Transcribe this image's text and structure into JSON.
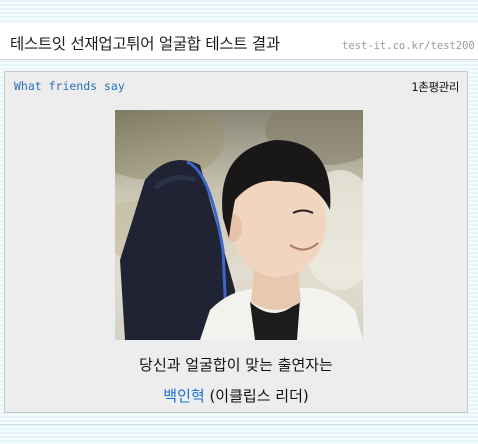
{
  "header": {
    "title": "테스트잇 선재업고튀어 얼굴합 테스트 결과",
    "url": "test-it.co.kr/test200"
  },
  "card": {
    "friends_label": "What friends say",
    "rating_label": "1촌평관리",
    "photo_icon": "person-photo",
    "result_prefix": "당신과 얼굴합이 맞는 출연자는",
    "result_name": "백인혁",
    "result_suffix": "(이클립스 리더)"
  },
  "colors": {
    "link_blue": "#2a6fc0",
    "name_blue": "#1a6fd6"
  }
}
